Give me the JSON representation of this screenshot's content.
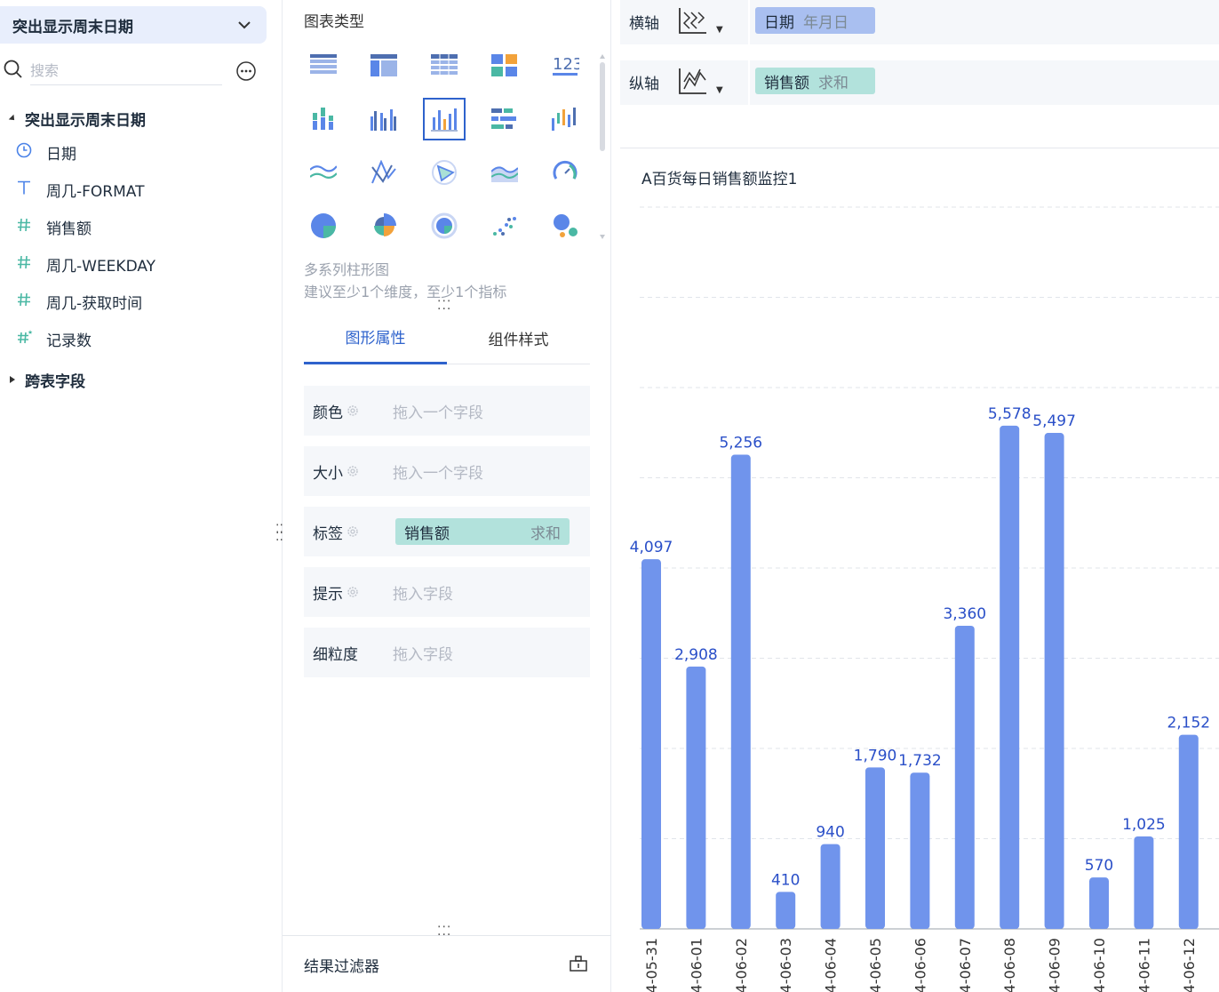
{
  "left_panel": {
    "dataset_name": "突出显示周末日期",
    "search_placeholder": "搜索",
    "group1_label": "突出显示周末日期",
    "fields": [
      {
        "icon": "clock-icon",
        "label": "日期"
      },
      {
        "icon": "text-icon",
        "label": "周几-FORMAT"
      },
      {
        "icon": "hash-icon",
        "label": "销售额"
      },
      {
        "icon": "hash-icon",
        "label": "周几-WEEKDAY"
      },
      {
        "icon": "hash-icon",
        "label": "周几-获取时间"
      },
      {
        "icon": "hash-star-icon",
        "label": "记录数"
      }
    ],
    "group2_label": "跨表字段"
  },
  "middle_panel": {
    "title": "图表类型",
    "selected_chart_name": "多系列柱形图",
    "selected_chart_hint": "建议至少1个维度，至少1个指标",
    "tabs": [
      "图形属性",
      "组件样式"
    ],
    "properties": [
      {
        "label": "颜色",
        "placeholder": "拖入一个字段"
      },
      {
        "label": "大小",
        "placeholder": "拖入一个字段"
      },
      {
        "label": "标签",
        "pill_field": "销售额",
        "pill_agg": "求和"
      },
      {
        "label": "提示",
        "placeholder": "拖入字段"
      },
      {
        "label": "细粒度",
        "placeholder": "拖入字段"
      }
    ],
    "result_filter_label": "结果过滤器"
  },
  "right_panel": {
    "x_axis": {
      "label": "横轴",
      "field": "日期",
      "sub": "年月日"
    },
    "y_axis": {
      "label": "纵轴",
      "field": "销售额",
      "sub": "求和"
    },
    "accent_color": "#7094ec",
    "label_color": "#2a4fc8"
  },
  "chart_data": {
    "type": "bar",
    "title": "A百货每日销售额监控1",
    "categories": [
      "4-05-31",
      "4-06-01",
      "4-06-02",
      "4-06-03",
      "4-06-04",
      "4-06-05",
      "4-06-06",
      "4-06-07",
      "4-06-08",
      "4-06-09",
      "4-06-10",
      "4-06-11",
      "4-06-12"
    ],
    "values": [
      4097,
      2908,
      5256,
      410,
      940,
      1790,
      1732,
      3360,
      5578,
      5497,
      570,
      1025,
      2152
    ],
    "data_labels": [
      "4,097",
      "2,908",
      "5,256",
      "410",
      "940",
      "1,790",
      "1,732",
      "3,360",
      "5,578",
      "5,497",
      "570",
      "1,025",
      "2,152"
    ],
    "ylim": [
      0,
      8000
    ],
    "grid": true,
    "xlabel": "",
    "ylabel": ""
  }
}
